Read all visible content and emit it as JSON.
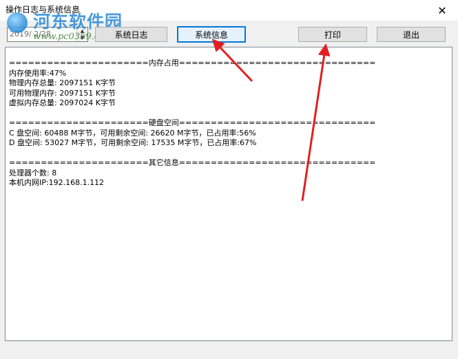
{
  "window": {
    "title": "操作日志与系统信息",
    "close_glyph": "✕"
  },
  "watermark": {
    "name": "河东软件园",
    "url": "www.pc0359.cn"
  },
  "toolbar": {
    "date_value": "2019/  2/28",
    "spin_up": "▲",
    "spin_down": "▼",
    "btn_log": "系统日志",
    "btn_sysinfo": "系统信息",
    "btn_print": "打印",
    "btn_exit": "退出"
  },
  "content": {
    "lines": [
      "======================内存占用===============================",
      "内存使用率:47%",
      "物理内存总量: 2097151 K字节",
      "可用物理内存: 2097151 K字节",
      "虚拟内存总量: 2097024 K字节",
      "",
      "======================硬盘空间===============================",
      "C 盘空间: 60488 M字节，可用剩余空间: 26620 M字节，已占用率:56%",
      "D 盘空间: 53027 M字节，可用剩余空间: 17535 M字节，已占用率:67%",
      "",
      "======================其它信息===============================",
      "处理器个数: 8",
      "本机内网IP:192.168.1.112"
    ]
  },
  "colors": {
    "annotation_arrow": "#e02020",
    "focus_border": "#0078d7",
    "watermark_blue": "#2a8ad8",
    "watermark_green": "#3a7e2e"
  }
}
